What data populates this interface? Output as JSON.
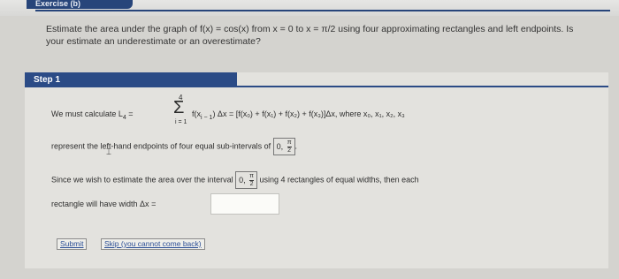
{
  "header": {
    "tab_label": "Exercise (b)"
  },
  "question": {
    "text": "Estimate the area under the graph of f(x) = cos(x) from x = 0 to x = π/2 using four approximating rectangles and left endpoints. Is your estimate an underestimate or an overestimate?"
  },
  "step": {
    "title": "Step 1",
    "line1_prefix": "We must calculate  L",
    "line1_sub": "4",
    "line1_eq": " =",
    "sum_top": "4",
    "sum_bottom": "i = 1",
    "line1_expr": "f(x",
    "line1_expr2": "i − 1",
    "line1_rest": ") Δx  =  [f(x₀) + f(x₁) + f(x₂) + f(x₃)]Δx,  where x₀, x₁, x₂, x₃",
    "line2_text": "represent the left-hand endpoints of four equal sub-intervals of",
    "interval_start": "0,",
    "interval_num": "π",
    "interval_den": "2",
    "line3_prefix": "Since we wish to estimate the area over the interval",
    "line3_suffix": "using 4 rectangles of equal widths, then each",
    "line4_text": "rectangle will have width  Δx =",
    "input_value": ""
  },
  "buttons": {
    "submit": "Submit",
    "skip": "Skip (you cannot come back)"
  }
}
